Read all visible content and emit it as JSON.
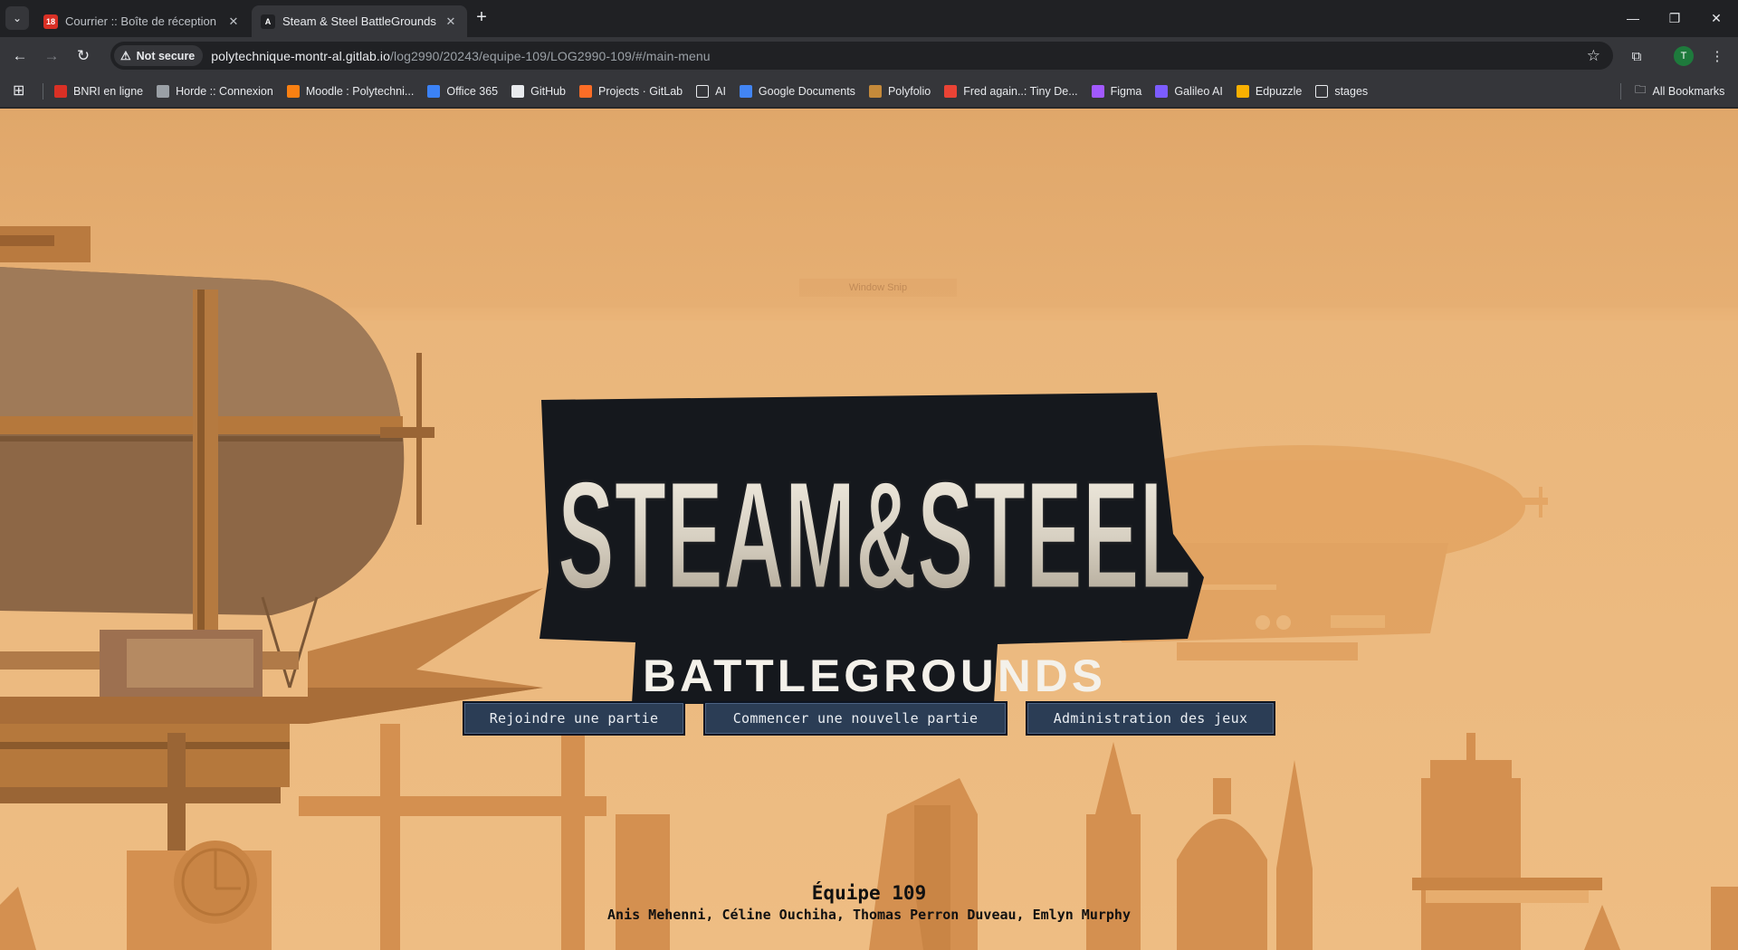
{
  "browser": {
    "tabs": [
      {
        "title": "Courrier :: Boîte de réception",
        "badge": "18",
        "active": false
      },
      {
        "title": "Steam & Steel BattleGrounds",
        "badge": "A",
        "active": true
      }
    ],
    "security_label": "Not secure",
    "url_host": "polytechnique-montr-al.gitlab.io",
    "url_path": "/log2990/20243/equipe-109/LOG2990-109/#/main-menu",
    "profile_initial": "T",
    "bookmarks": [
      {
        "label": "BNRI en ligne",
        "icon": "bnri-icon",
        "color": "#d93025"
      },
      {
        "label": "Horde :: Connexion",
        "icon": "horde-icon",
        "color": "#9aa0a6"
      },
      {
        "label": "Moodle : Polytechni...",
        "icon": "moodle-icon",
        "color": "#f98012"
      },
      {
        "label": "Office 365",
        "icon": "office-icon",
        "color": "#3b82f6"
      },
      {
        "label": "GitHub",
        "icon": "github-icon",
        "color": "#e8eaed"
      },
      {
        "label": "Projects · GitLab",
        "icon": "gitlab-icon",
        "color": "#fc6d26"
      },
      {
        "label": "AI",
        "icon": "folder-icon",
        "color": "#e8eaed"
      },
      {
        "label": "Google Documents",
        "icon": "docs-icon",
        "color": "#4285f4"
      },
      {
        "label": "Polyfolio",
        "icon": "polyfolio-icon",
        "color": "#c58a3a"
      },
      {
        "label": "Fred again..: Tiny De...",
        "icon": "fred-icon",
        "color": "#ea4335"
      },
      {
        "label": "Figma",
        "icon": "figma-icon",
        "color": "#a259ff"
      },
      {
        "label": "Galileo AI",
        "icon": "galileo-icon",
        "color": "#7c5cff"
      },
      {
        "label": "Edpuzzle",
        "icon": "edpuzzle-icon",
        "color": "#f9b000"
      },
      {
        "label": "stages",
        "icon": "folder-icon",
        "color": "#e8eaed"
      }
    ],
    "all_bookmarks": "All Bookmarks"
  },
  "page": {
    "snip_label": "Window Snip",
    "logo": {
      "line1": "STEAM&STEEL",
      "line2": "BATTLEGROUNDS"
    },
    "buttons": {
      "join": "Rejoindre une partie",
      "create": "Commencer une nouvelle partie",
      "admin": "Administration des jeux"
    },
    "team_title": "Équipe 109",
    "team_members": "Anis Mehenni, Céline Ouchiha, Thomas Perron Duveau, Emlyn Murphy",
    "colors": {
      "button_bg": "#2b3d55",
      "button_border": "#0d1420",
      "sky": "#ecba80",
      "silhouette": "#d18a45"
    }
  }
}
